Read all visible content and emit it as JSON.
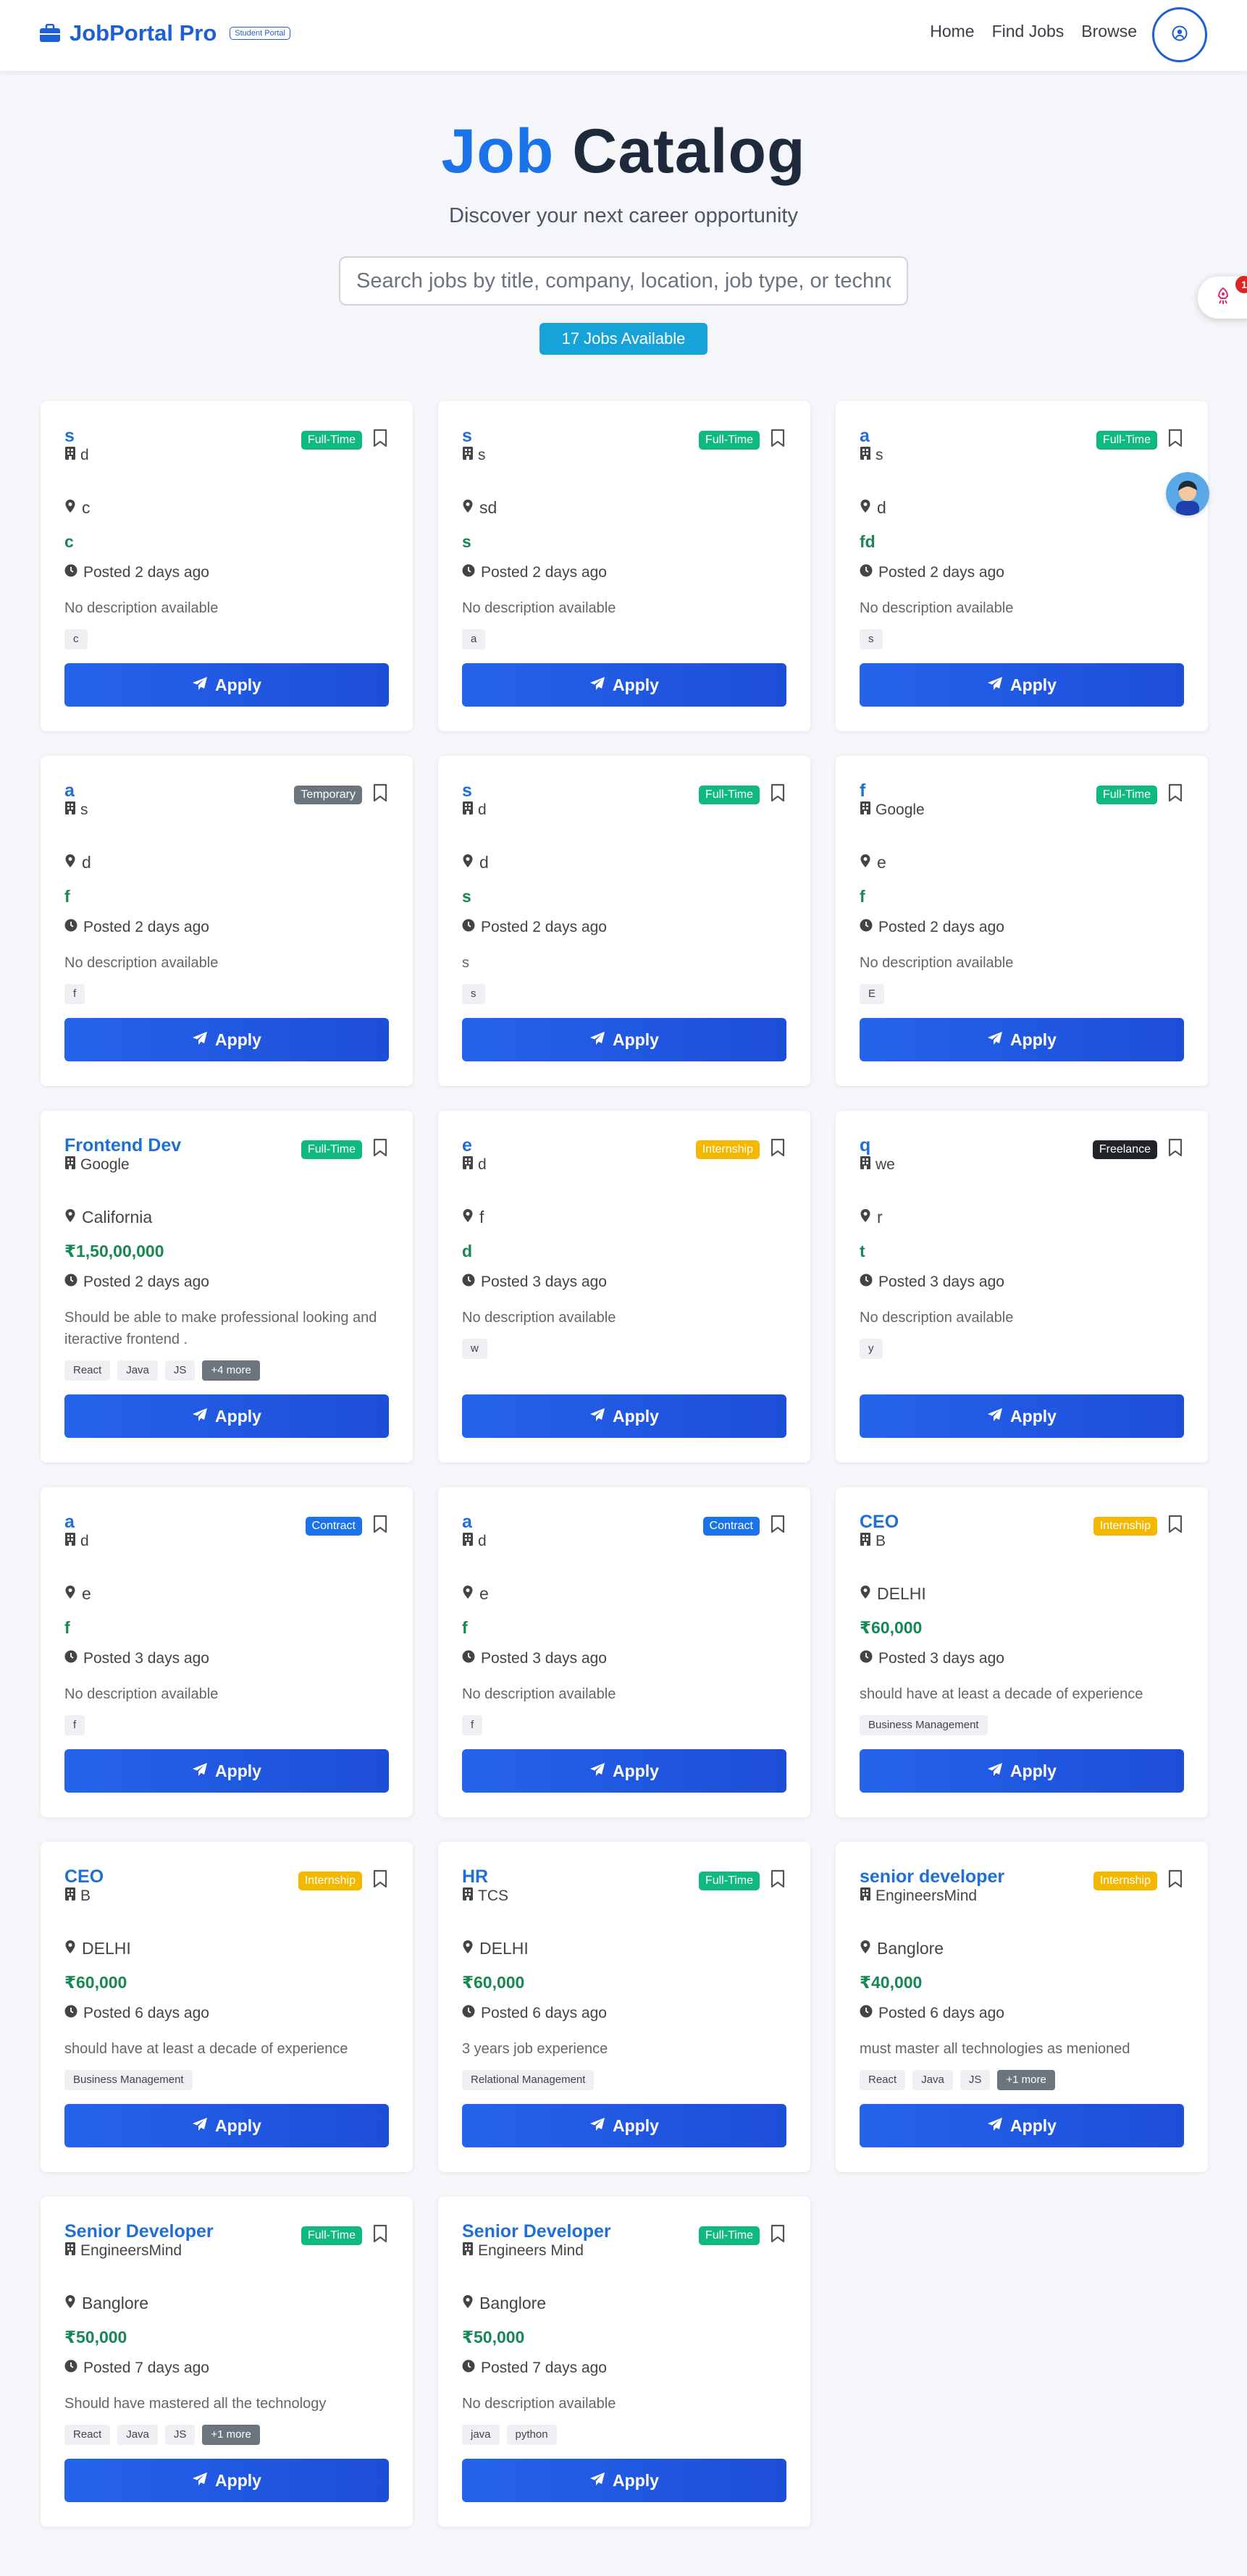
{
  "navbar": {
    "brand": "JobPortal Pro",
    "badge": "Student Portal",
    "links": [
      "Home",
      "Find Jobs",
      "Browse"
    ]
  },
  "hero": {
    "title_accent": "Job",
    "title_rest": "Catalog",
    "subtitle": "Discover your next career opportunity",
    "search_placeholder": "Search jobs by title, company, location, job type, or technology...",
    "count_label": "17 Jobs Available"
  },
  "widget": {
    "count": "1"
  },
  "colors": {
    "brand": "#1f5fd6",
    "full_time": "#10b981",
    "internship": "#f5b800",
    "contract": "#1a73e8",
    "temporary": "#6c757d",
    "freelance": "#212529",
    "salary": "#198754"
  },
  "apply_label": "Apply",
  "jobs": [
    {
      "title": "s",
      "company": "d",
      "type": "Full-Time",
      "location": "c",
      "salary": "c",
      "posted": "Posted 2 days ago",
      "description": "No description available",
      "tags": [
        "c"
      ]
    },
    {
      "title": "s",
      "company": "s",
      "type": "Full-Time",
      "location": "sd",
      "salary": "s",
      "posted": "Posted 2 days ago",
      "description": "No description available",
      "tags": [
        "a"
      ]
    },
    {
      "title": "a",
      "company": "s",
      "type": "Full-Time",
      "location": "d",
      "salary": "fd",
      "posted": "Posted 2 days ago",
      "description": "No description available",
      "tags": [
        "s"
      ]
    },
    {
      "title": "a",
      "company": "s",
      "type": "Temporary",
      "location": "d",
      "salary": "f",
      "posted": "Posted 2 days ago",
      "description": "No description available",
      "tags": [
        "f"
      ]
    },
    {
      "title": "s",
      "company": "d",
      "type": "Full-Time",
      "location": "d",
      "salary": "s",
      "posted": "Posted 2 days ago",
      "description": "s",
      "tags": [
        "s"
      ]
    },
    {
      "title": "f",
      "company": "Google",
      "type": "Full-Time",
      "location": "e",
      "salary": "f",
      "posted": "Posted 2 days ago",
      "description": "No description available",
      "tags": [
        "E"
      ]
    },
    {
      "title": "Frontend Dev",
      "company": "Google",
      "type": "Full-Time",
      "location": "California",
      "salary": "₹1,50,00,000",
      "posted": "Posted 2 days ago",
      "description": "Should be able to make professional looking and iteractive frontend .",
      "tags": [
        "React",
        "Java",
        "JS"
      ],
      "more": "+4 more"
    },
    {
      "title": "e",
      "company": "d",
      "type": "Internship",
      "location": "f",
      "salary": "d",
      "posted": "Posted 3 days ago",
      "description": "No description available",
      "tags": [
        "w"
      ]
    },
    {
      "title": "q",
      "company": "we",
      "type": "Freelance",
      "location": "r",
      "salary": "t",
      "posted": "Posted 3 days ago",
      "description": "No description available",
      "tags": [
        "y"
      ]
    },
    {
      "title": "a",
      "company": "d",
      "type": "Contract",
      "location": "e",
      "salary": "f",
      "posted": "Posted 3 days ago",
      "description": "No description available",
      "tags": [
        "f"
      ]
    },
    {
      "title": "a",
      "company": "d",
      "type": "Contract",
      "location": "e",
      "salary": "f",
      "posted": "Posted 3 days ago",
      "description": "No description available",
      "tags": [
        "f"
      ]
    },
    {
      "title": "CEO",
      "company": "B",
      "type": "Internship",
      "location": "DELHI",
      "salary": "₹60,000",
      "posted": "Posted 3 days ago",
      "description": "should have at least a decade of experience",
      "tags": [
        "Business Management"
      ]
    },
    {
      "title": "CEO",
      "company": "B",
      "type": "Internship",
      "location": "DELHI",
      "salary": "₹60,000",
      "posted": "Posted 6 days ago",
      "description": "should have at least a decade of experience",
      "tags": [
        "Business Management"
      ]
    },
    {
      "title": "HR",
      "company": "TCS",
      "type": "Full-Time",
      "location": "DELHI",
      "salary": "₹60,000",
      "posted": "Posted 6 days ago",
      "description": "3 years job experience",
      "tags": [
        "Relational Management"
      ]
    },
    {
      "title": "senior developer",
      "company": "EngineersMind",
      "type": "Internship",
      "location": "Banglore",
      "salary": "₹40,000",
      "posted": "Posted 6 days ago",
      "description": "must master all technologies as menioned",
      "tags": [
        "React",
        "Java",
        "JS"
      ],
      "more": "+1 more"
    },
    {
      "title": "Senior Developer",
      "company": "EngineersMind",
      "type": "Full-Time",
      "location": "Banglore",
      "salary": "₹50,000",
      "posted": "Posted 7 days ago",
      "description": "Should have mastered all the technology",
      "tags": [
        "React",
        "Java",
        "JS"
      ],
      "more": "+1 more"
    },
    {
      "title": "Senior Developer",
      "company": "Engineers Mind",
      "type": "Full-Time",
      "location": "Banglore",
      "salary": "₹50,000",
      "posted": "Posted 7 days ago",
      "description": "No description available",
      "tags": [
        "java",
        "python"
      ]
    }
  ]
}
